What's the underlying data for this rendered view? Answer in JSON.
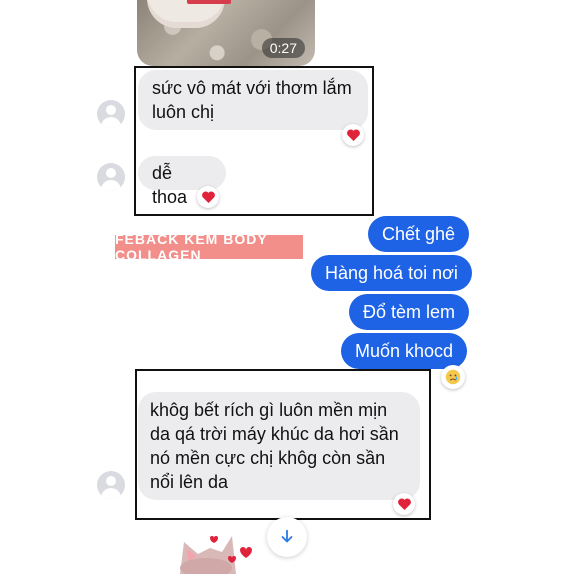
{
  "video": {
    "duration": "0:27"
  },
  "messages": {
    "incoming_1": "sức vô mát với thơm lắm luôn chị",
    "incoming_2": "dễ thoa",
    "incoming_3": "khôg bết rích gì luôn mền mịn da qá trời máy khúc da hơi sần nó mền cực chị khôg còn sần nổi lên da"
  },
  "outgoing": [
    "Chết ghê",
    "Hàng hoá toi nơi",
    "Đổ tèm lem",
    "Muốn khocd"
  ],
  "tag_text": "FEBACK KEM BODY COLLAGEN",
  "colors": {
    "outgoing_bubble": "#1e63e6",
    "incoming_bubble": "#ececee",
    "tag": "#f28f8b",
    "heart": "#e0233a"
  },
  "icons": {
    "reaction": "heart-icon",
    "reaction_2": "sad-face-icon",
    "scroll": "arrow-down-icon",
    "sticker": "cat-sticker-icon"
  }
}
